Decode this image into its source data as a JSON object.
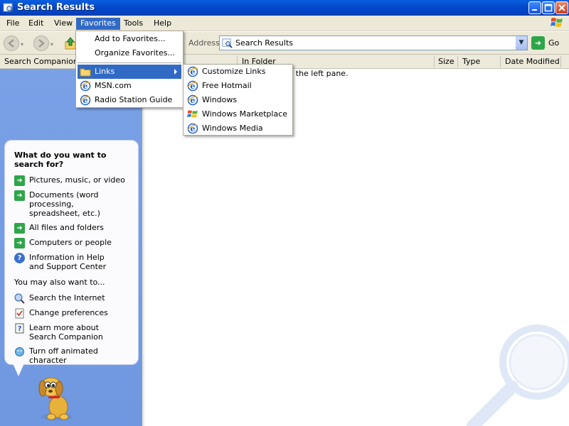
{
  "window": {
    "title": "Search Results"
  },
  "menubar": {
    "items": [
      "File",
      "Edit",
      "View",
      "Favorites",
      "Tools",
      "Help"
    ],
    "active": "Favorites"
  },
  "toolbar": {
    "address_label": "Address",
    "address_value": "Search Results",
    "go_label": "Go"
  },
  "search_companion": {
    "header": "Search Companion",
    "question": "What do you want to search for?",
    "options": [
      {
        "label": "Pictures, music, or video",
        "icon": "green-arrow-icon"
      },
      {
        "label": "Documents (word processing, spreadsheet, etc.)",
        "icon": "green-arrow-icon"
      },
      {
        "label": "All files and folders",
        "icon": "green-arrow-icon"
      },
      {
        "label": "Computers or people",
        "icon": "green-arrow-icon"
      },
      {
        "label": "Information in Help and Support Center",
        "icon": "help-icon"
      }
    ],
    "also_header": "You may also want to...",
    "also_options": [
      {
        "label": "Search the Internet",
        "icon": "internet-search-icon"
      },
      {
        "label": "Change preferences",
        "icon": "preferences-icon"
      },
      {
        "label": "Learn more about Search Companion",
        "icon": "help-book-icon"
      },
      {
        "label": "Turn off animated character",
        "icon": "character-icon"
      }
    ]
  },
  "results": {
    "columns": [
      "In Folder",
      "Size",
      "Type",
      "Date Modified"
    ],
    "empty_fragment": "s in the left pane."
  },
  "favorites_menu": {
    "items": [
      {
        "label": "Add to Favorites...",
        "icon": ""
      },
      {
        "label": "Organize Favorites...",
        "icon": ""
      },
      {
        "label": "Links",
        "icon": "folder-icon",
        "highlighted": true,
        "submenu": true
      },
      {
        "label": "MSN.com",
        "icon": "ie-icon"
      },
      {
        "label": "Radio Station Guide",
        "icon": "ie-icon"
      }
    ]
  },
  "links_submenu": {
    "items": [
      {
        "label": "Customize Links",
        "icon": "ie-icon"
      },
      {
        "label": "Free Hotmail",
        "icon": "ie-icon"
      },
      {
        "label": "Windows",
        "icon": "ie-icon"
      },
      {
        "label": "Windows Marketplace",
        "icon": "windows-flag-icon"
      },
      {
        "label": "Windows Media",
        "icon": "ie-icon"
      }
    ]
  },
  "colors": {
    "titlebar": "#0548c9",
    "highlight": "#316ac5",
    "pane_blue": "#7aa1e6",
    "menubar": "#ece9d8"
  }
}
